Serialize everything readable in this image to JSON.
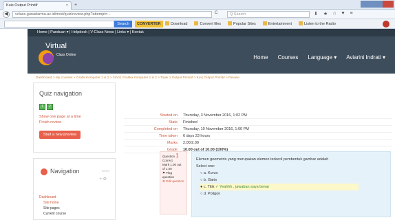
{
  "browser": {
    "tab_title": "Kuis Output Prinitif",
    "tab_close": "×",
    "new_tab": "+",
    "url": "vclass.gunadarma.ac.id/mod/quiz/review.php?attempt=...",
    "search_placeholder": "Q Search",
    "back": "◀",
    "reload": "C",
    "toolbar_search_button": "Search",
    "converter_label": "CONVERTER",
    "toolbar_links": [
      "Download",
      "Convert files",
      "Popular Sites",
      "Entertainment",
      "Listen to the Radio"
    ]
  },
  "moodle": {
    "topnav": "Home | Panduan ▾ | Helpdesk | V-Class News | Links ▾ | Kontak",
    "logo_title": "Virtual",
    "logo_sub": "Class Online",
    "nav": [
      "Home",
      "Courses",
      "Language ▾",
      "Aviarini Indrati ▾"
    ],
    "breadcrumb": "Dashboard > My courses > Grafik Komputer 1 & 2 > 3IA01 Grafika Komputer 1 & 2 > Topik 1 Output Primitif > Kuis Output Primitif > Review"
  },
  "quiz_nav": {
    "title": "Quiz navigation",
    "boxes": [
      "1",
      "2"
    ],
    "show_one_page": "Show one page at a time",
    "finish_review": "Finish review",
    "start_new": "Start a new preview"
  },
  "navigation": {
    "title": "Navigation",
    "dashboard": "Dashboard",
    "items": [
      "Site home",
      "Site pages",
      "Current course"
    ]
  },
  "summary": [
    {
      "key": "Started on",
      "value": "Thursday, 3 November 2016, 1:02 PM"
    },
    {
      "key": "State",
      "value": "Finished"
    },
    {
      "key": "Completed on",
      "value": "Thursday, 10 November 2016, 1:00 PM"
    },
    {
      "key": "Time taken",
      "value": "6 days 23 hours"
    },
    {
      "key": "Marks",
      "value": "2.00/2.00"
    },
    {
      "key": "Grade",
      "value": "10.00 out of 10.00 (100%)"
    }
  ],
  "question": {
    "label": "Question",
    "number": "1",
    "status": "Correct",
    "mark": "Mark 1.00 out of 1.00",
    "flag": "Flag question",
    "edit": "Edit question",
    "text": "Elemen geometris yang merupakan elemen terkecil pembentuk gambar adalah",
    "select_one": "Select one:",
    "options": [
      "a. Kurva",
      "b. Garis",
      "c. Titik",
      "d. Poligon"
    ],
    "selected_feedback": "Yeahhh , jawaban saya benar"
  }
}
